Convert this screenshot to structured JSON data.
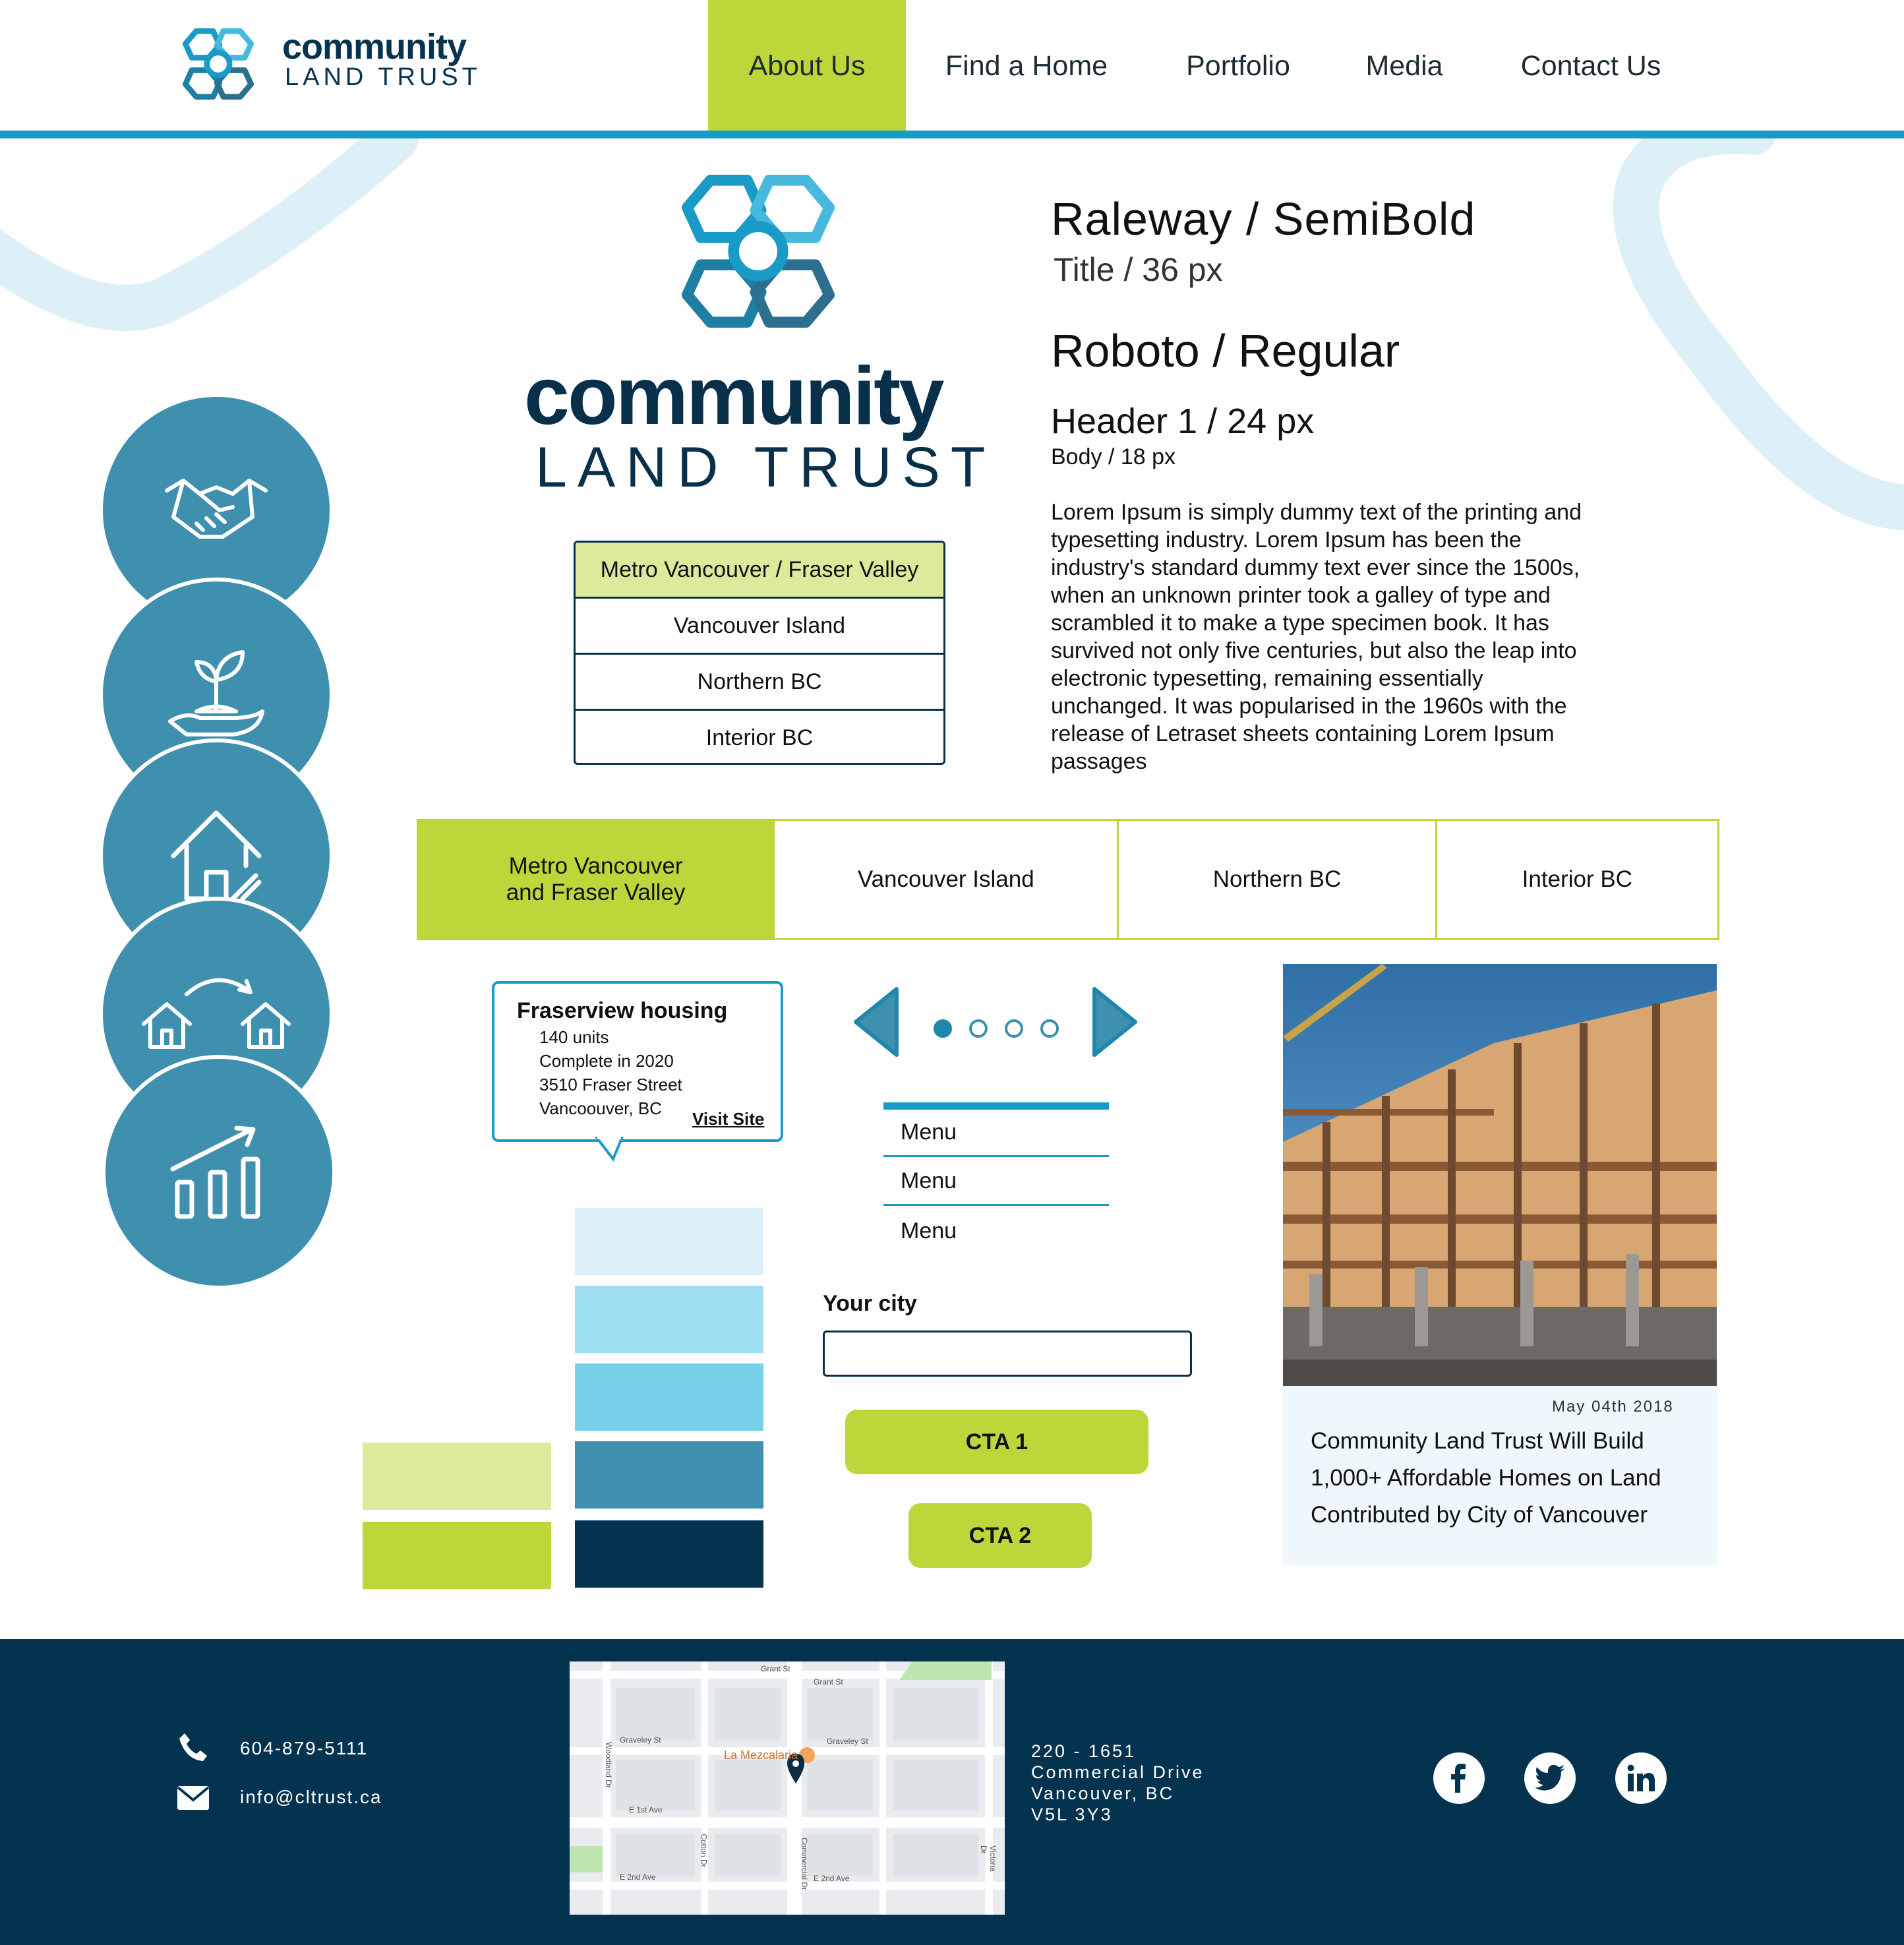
{
  "brand": {
    "name_line1": "community",
    "name_line2": "LAND TRUST",
    "colors": {
      "accent_green": "#bdd73a",
      "light_green": "#dde99b",
      "primary_blue": "#1a9ac7",
      "teal": "#3f8fae",
      "navy": "#043350"
    }
  },
  "nav": {
    "items": [
      {
        "label": "About Us",
        "active": true
      },
      {
        "label": "Find a Home"
      },
      {
        "label": "Portfolio"
      },
      {
        "label": "Media"
      },
      {
        "label": "Contact Us"
      }
    ]
  },
  "typography": {
    "title_font": "Raleway /  SemiBold",
    "title_spec": "Title / 36 px",
    "header_font": "Roboto / Regular",
    "header_spec": "Header 1 / 24 px",
    "body_spec": "Body / 18 px",
    "sample_paragraph": "Lorem Ipsum is simply dummy text of the printing and typesetting industry. Lorem Ipsum has been the industry's standard dummy text ever since the 1500s, when an unknown printer took a galley of type and scrambled it to make a type specimen book. It has survived not only five centuries, but also the leap into electronic typesetting, remaining essentially unchanged. It was popularised in the 1960s with the release of Letraset sheets containing Lorem Ipsum passages"
  },
  "dropdown": {
    "items": [
      "Metro Vancouver / Fraser Valley",
      "Vancouver Island",
      "Northern BC",
      "Interior BC"
    ],
    "selected_index": 0
  },
  "tabs": {
    "items": [
      "Metro Vancouver and Fraser Valley",
      "Vancouver Island",
      "Northern BC",
      "Interior BC"
    ],
    "active_index": 0
  },
  "tooltip": {
    "title": "Fraserview housing",
    "lines": [
      "140 units",
      "Complete in 2020",
      "3510 Fraser Street",
      "Vancoouver, BC"
    ],
    "link": "Visit Site"
  },
  "carousel": {
    "total": 4,
    "current": 1
  },
  "menu": {
    "items": [
      "Menu",
      "Menu",
      "Menu"
    ]
  },
  "form": {
    "label": "Your city",
    "value": ""
  },
  "buttons": {
    "cta1": "CTA 1",
    "cta2": "CTA 2"
  },
  "swatches": [
    "#dbeff8",
    "#9fdff3",
    "#76d0e9",
    "#3f8fae",
    "#043350",
    "#dde99b",
    "#bdd73a"
  ],
  "news": {
    "date": "May 04th 2018",
    "title": "Community Land Trust Will Build 1,000+ Affordable Homes on Land Contributed by City of Vancouver"
  },
  "icons": [
    "handshake-icon",
    "plant-hand-icon",
    "house-icon",
    "house-transfer-icon",
    "growth-chart-icon"
  ],
  "footer": {
    "phone": "604-879-5111",
    "email": "info@cltrust.ca",
    "address_line1": "220 - 1651",
    "address_line2": "Commercial Drive",
    "address_line3": "Vancouver, BC",
    "address_line4": "V5L 3Y3",
    "social": [
      "facebook-icon",
      "twitter-icon",
      "linkedin-icon"
    ]
  },
  "map": {
    "labels": [
      "Grant St",
      "Grant St",
      "Graveley St",
      "Graveley St",
      "La Mezcalaria",
      "Woodland Dr",
      "E 1st Ave",
      "Cotton Dr",
      "Commercial Dr",
      "E 2nd Ave",
      "E 2nd Ave",
      "Victoria Dr"
    ]
  }
}
